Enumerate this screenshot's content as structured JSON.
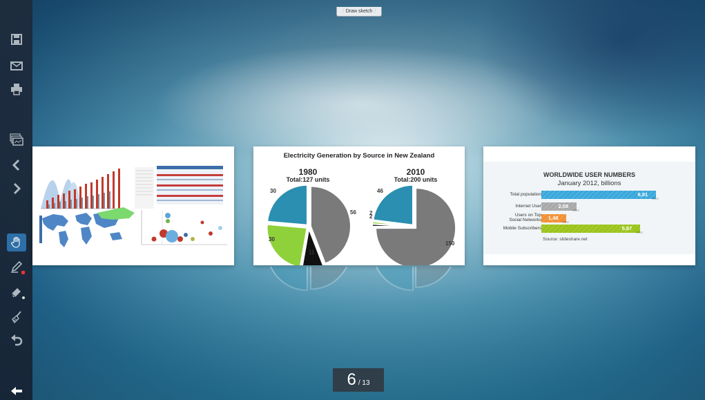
{
  "top_tab": {
    "label": "Draw sketch"
  },
  "toolbar": {
    "items": [
      {
        "name": "save",
        "icon": "save-icon"
      },
      {
        "name": "email",
        "icon": "envelope-icon"
      },
      {
        "name": "print",
        "icon": "printer-icon"
      },
      {
        "name": "overview",
        "icon": "slides-overview-icon"
      },
      {
        "name": "prev",
        "icon": "chevron-left-icon"
      },
      {
        "name": "next",
        "icon": "chevron-right-icon"
      },
      {
        "name": "pan",
        "icon": "hand-icon",
        "active": true
      },
      {
        "name": "pen",
        "icon": "pen-icon"
      },
      {
        "name": "eraser",
        "icon": "eraser-icon"
      },
      {
        "name": "clear",
        "icon": "broom-icon"
      },
      {
        "name": "undo",
        "icon": "undo-icon"
      }
    ],
    "back_icon": "arrow-left-icon"
  },
  "pager": {
    "current": "6",
    "total": "/ 13"
  },
  "slides": [
    {
      "id": "slide-5",
      "content": "chart collage thumbnail"
    },
    {
      "id": "slide-6",
      "chart_data": {
        "type": "pie",
        "title": "Electricity Generation by Source in New Zealand",
        "pies": [
          {
            "year": "1980",
            "total": "Total:127 units",
            "values": [
              56,
              11,
              30,
              30
            ],
            "labels": [
              "56",
              "11",
              "30",
              "30"
            ],
            "colors": [
              "#7a7a7a",
              "#111111",
              "#8fd13a",
              "#2a8fb0"
            ]
          },
          {
            "year": "2010",
            "total": "Total:200 units",
            "values": [
              150,
              2,
              2,
              46
            ],
            "labels": [
              "150",
              "2",
              "2",
              "46"
            ],
            "colors": [
              "#7a7a7a",
              "#111111",
              "#8fd13a",
              "#2a8fb0"
            ]
          }
        ]
      }
    },
    {
      "id": "slide-7",
      "title": "WORLDWIDE USER NUMBERS",
      "subtitle": "January 2012, billions",
      "chart_data": {
        "type": "bar",
        "categories": [
          "Total population",
          "Internet User",
          "Users on Top Social Networks",
          "Mobile Subscribers"
        ],
        "values": [
          6.81,
          2.08,
          1.48,
          5.87
        ],
        "value_labels": [
          "6,81",
          "2,08",
          "1,48",
          "5,87"
        ],
        "colors": [
          "#3aa8dc",
          "#a9a9a9",
          "#f39034",
          "#9bc41c"
        ]
      },
      "label_lines": [
        [
          "Total population"
        ],
        [
          "Internet User"
        ],
        [
          "Users on Top",
          "Social Networks"
        ],
        [
          "Mobile Subscribers"
        ]
      ],
      "source": "Source:  slideshare.net"
    }
  ]
}
